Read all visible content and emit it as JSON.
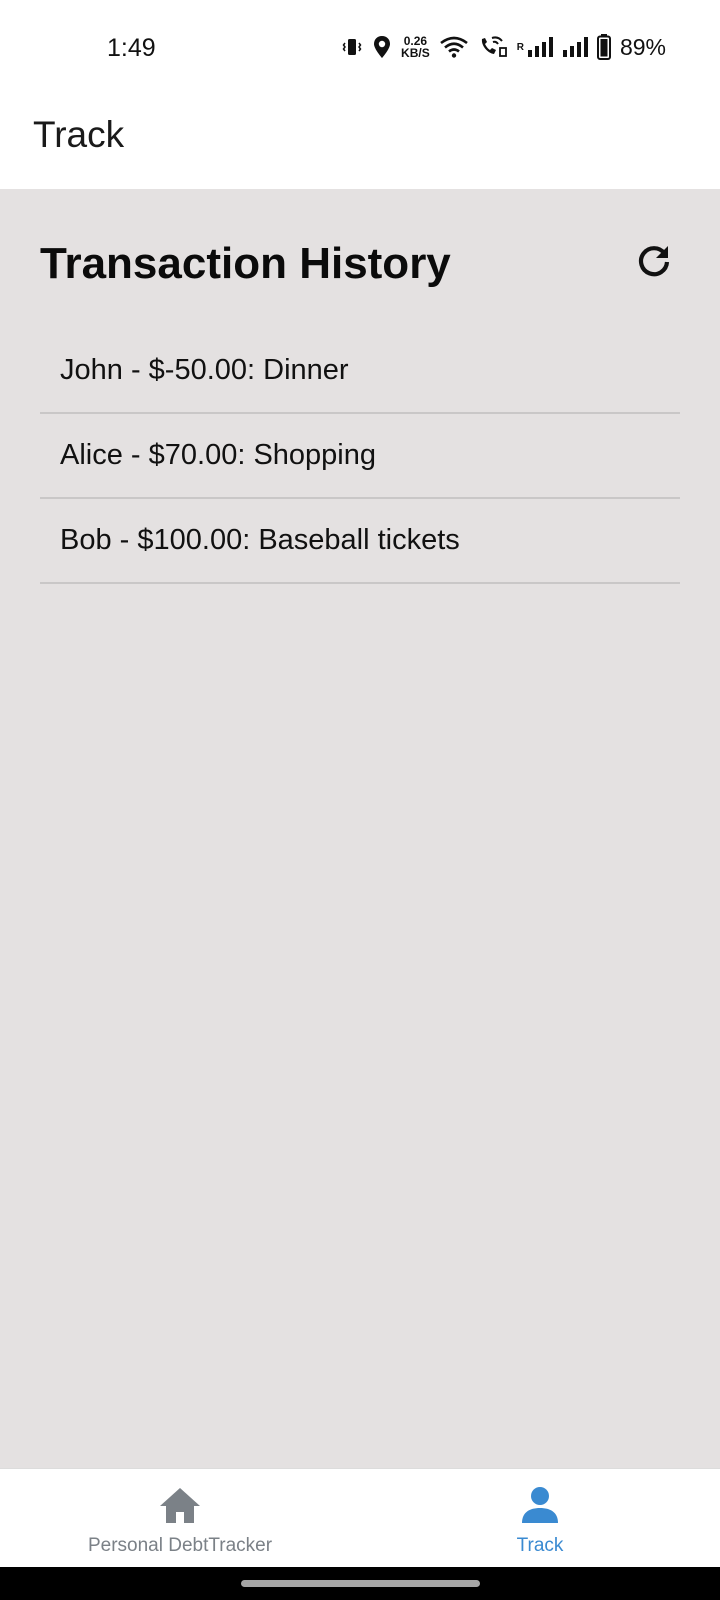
{
  "status_bar": {
    "time": "1:49",
    "net_speed_value": "0.26",
    "net_speed_unit": "KB/S",
    "roaming": "R",
    "battery_percent": "89%",
    "icons": [
      "vibrate-icon",
      "location-icon",
      "wifi-icon",
      "wifi-calling-icon",
      "signal-icon",
      "signal-icon",
      "battery-icon"
    ]
  },
  "app_bar": {
    "title": "Track"
  },
  "history": {
    "title": "Transaction History",
    "refresh_icon": "refresh-icon",
    "items": [
      "John - $-50.00: Dinner",
      "Alice - $70.00: Shopping",
      "Bob - $100.00: Baseball tickets"
    ]
  },
  "bottom_nav": {
    "tabs": [
      {
        "label": "Personal DebtTracker",
        "icon": "home-icon",
        "active": false
      },
      {
        "label": "Track",
        "icon": "person-icon",
        "active": true
      }
    ]
  },
  "colors": {
    "content_background": "#e4e1e1",
    "active_tab": "#3a8ad1",
    "inactive_tab": "#7b8187",
    "divider": "#c9c7c7"
  }
}
